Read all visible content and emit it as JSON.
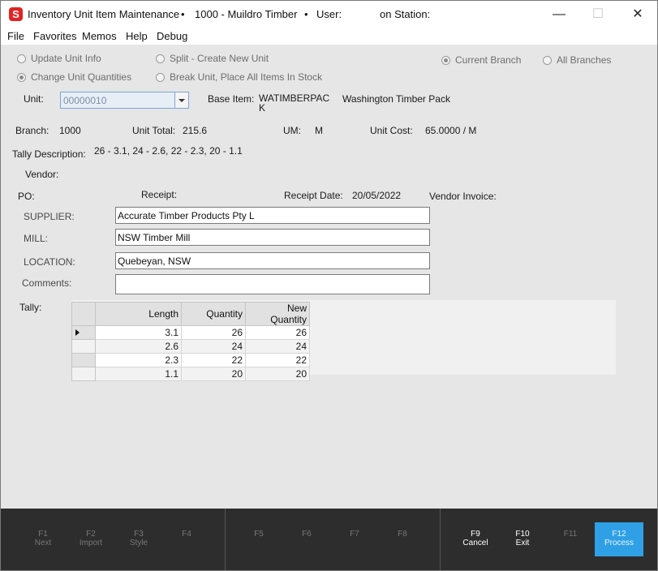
{
  "titlebar": {
    "app_icon": "S",
    "title": "Inventory Unit Item Maintenance",
    "sep1": "•",
    "branch_label": "1000 - Muildro Timber",
    "sep2": "•",
    "user_label": "User:",
    "station_label": "on Station:",
    "minimize": "—",
    "maximize": "☐",
    "close": "✕"
  },
  "menu": [
    "File",
    "Favorites",
    "Memos",
    "Help",
    "Debug"
  ],
  "options": {
    "update_unit_info": "Update Unit Info",
    "change_unit_quantities": "Change Unit Quantities",
    "split_create_new_unit": "Split - Create New Unit",
    "break_unit": "Break Unit, Place All Items In Stock",
    "current_branch": "Current Branch",
    "all_branches": "All Branches",
    "selected_mode": "change_unit_quantities",
    "selected_scope": "current_branch"
  },
  "unit": {
    "label": "Unit:",
    "value": "00000010",
    "base_item_label": "Base Item:",
    "base_item_code_line1": "WATIMBERPAC",
    "base_item_code_line2": "K",
    "base_item_desc": "Washington Timber Pack"
  },
  "info": {
    "branch_label": "Branch:",
    "branch_value": "1000",
    "unit_total_label": "Unit Total:",
    "unit_total_value": "215.6",
    "um_label": "UM:",
    "um_value": "M",
    "unit_cost_label": "Unit Cost:",
    "unit_cost_value": "65.0000 / M",
    "tally_desc_label": "Tally Description:",
    "tally_desc_value": "26 - 3.1, 24 - 2.6, 22 - 2.3, 20 - 1.1",
    "vendor_label": "Vendor:",
    "po_label": "PO:",
    "receipt_label": "Receipt:",
    "receipt_date_label": "Receipt Date:",
    "receipt_date_value": "20/05/2022",
    "vendor_invoice_label": "Vendor Invoice:"
  },
  "fields": {
    "supplier_label": "SUPPLIER:",
    "supplier_value": "Accurate Timber Products Pty L",
    "mill_label": "MILL:",
    "mill_value": "NSW Timber Mill",
    "location_label": "LOCATION:",
    "location_value": "Quebeyan, NSW",
    "comments_label": "Comments:",
    "comments_value": ""
  },
  "tally": {
    "label": "Tally:",
    "columns": [
      "Length",
      "Quantity",
      "New Quantity"
    ],
    "rows": [
      [
        "3.1",
        "26",
        "26"
      ],
      [
        "2.6",
        "24",
        "24"
      ],
      [
        "2.3",
        "22",
        "22"
      ],
      [
        "1.1",
        "20",
        "20"
      ]
    ]
  },
  "fkeys": {
    "f1": {
      "key": "F1",
      "label": "Next"
    },
    "f2": {
      "key": "F2",
      "label": "Import"
    },
    "f3": {
      "key": "F3",
      "label": "Style"
    },
    "f4": {
      "key": "F4",
      "label": ""
    },
    "f5": {
      "key": "F5",
      "label": ""
    },
    "f6": {
      "key": "F6",
      "label": ""
    },
    "f7": {
      "key": "F7",
      "label": ""
    },
    "f8": {
      "key": "F8",
      "label": ""
    },
    "f9": {
      "key": "F9",
      "label": "Cancel"
    },
    "f10": {
      "key": "F10",
      "label": "Exit"
    },
    "f11": {
      "key": "F11",
      "label": ""
    },
    "f12": {
      "key": "F12",
      "label": "Process"
    }
  }
}
